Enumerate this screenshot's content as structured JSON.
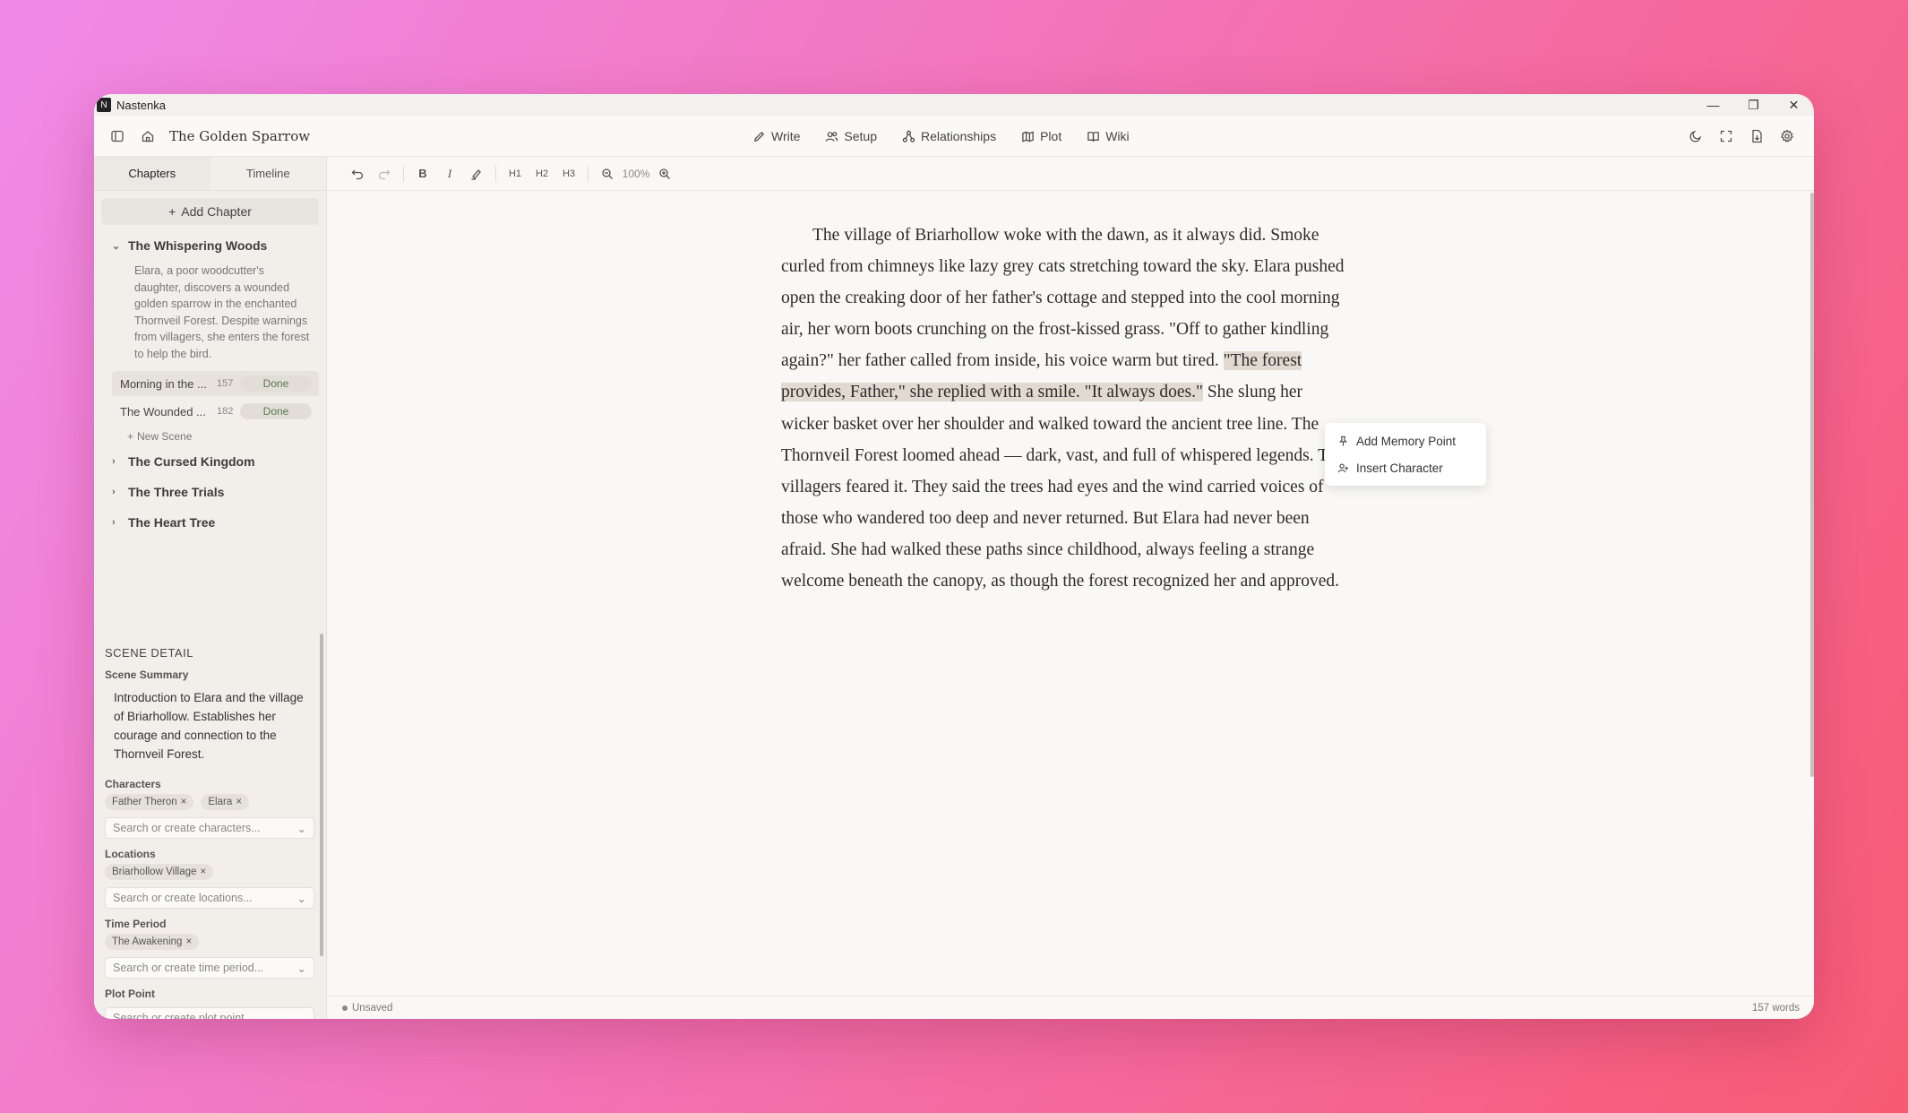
{
  "app": {
    "name": "Nastenka",
    "doc_title": "The Golden Sparrow"
  },
  "window_controls": {
    "minimize": "—",
    "maximize": "❐",
    "close": "✕"
  },
  "modes": [
    {
      "label": "Write",
      "icon": "pen-icon"
    },
    {
      "label": "Setup",
      "icon": "users-icon"
    },
    {
      "label": "Relationships",
      "icon": "network-icon"
    },
    {
      "label": "Plot",
      "icon": "map-icon"
    },
    {
      "label": "Wiki",
      "icon": "book-icon"
    }
  ],
  "sidebar": {
    "tabs": [
      "Chapters",
      "Timeline"
    ],
    "add_chapter": "Add Chapter",
    "chapters": [
      {
        "title": "The Whispering Woods",
        "expanded": true,
        "summary": "Elara, a poor woodcutter's daughter, discovers a wounded golden sparrow in the enchanted Thornveil Forest. Despite warnings from villagers, she enters the forest to help the bird.",
        "scenes": [
          {
            "name": "Morning in the ...",
            "count": "157",
            "status": "Done"
          },
          {
            "name": "The Wounded ...",
            "count": "182",
            "status": "Done"
          }
        ],
        "new_scene": "New Scene"
      },
      {
        "title": "The Cursed Kingdom"
      },
      {
        "title": "The Three Trials"
      },
      {
        "title": "The Heart Tree"
      }
    ]
  },
  "detail": {
    "heading": "SCENE DETAIL",
    "summary_label": "Scene Summary",
    "summary": "Introduction to Elara and the village of Briarhollow. Establishes her courage and connection to the Thornveil Forest.",
    "characters_label": "Characters",
    "characters": [
      "Father Theron",
      "Elara"
    ],
    "characters_placeholder": "Search or create characters...",
    "locations_label": "Locations",
    "locations": [
      "Briarhollow Village"
    ],
    "locations_placeholder": "Search or create locations...",
    "time_label": "Time Period",
    "time_periods": [
      "The Awakening"
    ],
    "time_placeholder": "Search or create time period...",
    "plot_label": "Plot Point",
    "plot_placeholder": "Search or create plot point..."
  },
  "toolbar": {
    "zoom": "100%",
    "h1": "H1",
    "h2": "H2",
    "h3": "H3"
  },
  "editor": {
    "before": "The village of Briarhollow woke with the dawn, as it always did. Smoke curled from chimneys like lazy grey cats stretching toward the sky. Elara pushed open the creaking door of her father's cottage and stepped into the cool morning air, her worn boots crunching on the frost-kissed grass. \"Off to gather kindling again?\" her father called from inside, his voice warm but tired. ",
    "highlighted": "\"The forest provides, Father,\" she replied with a smile. \"It always does.\"",
    "after": " She slung her wicker basket over her shoulder and walked toward the ancient tree line. The Thornveil Forest loomed ahead — dark, vast, and full of whispered legends. The villagers feared it. They said the trees had eyes and the wind carried voices of those who wandered too deep and never returned. But Elara had never been afraid. She had walked these paths since childhood, always feeling a strange welcome beneath the canopy, as though the forest recognized her and approved."
  },
  "context_menu": [
    "Add Memory Point",
    "Insert Character"
  ],
  "status": {
    "save_state": "Unsaved",
    "word_count": "157 words"
  }
}
